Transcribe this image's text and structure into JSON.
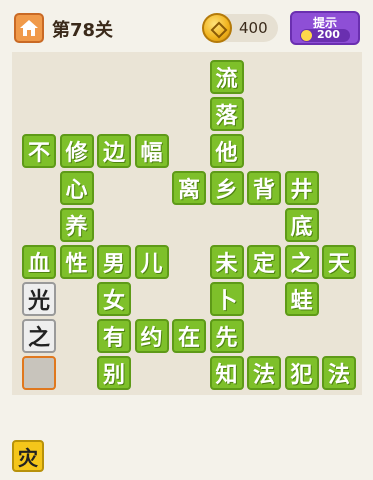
{
  "header": {
    "level_title": "第78关",
    "coins": "400",
    "hint_label": "提示",
    "hint_cost": "200"
  },
  "colors": {
    "tile_green": "#7ec02a",
    "hint_purple": "#8e4fd6",
    "home_orange": "#f09a4a",
    "slot_border": "#e0781e",
    "candidate_yellow": "#f5c61a"
  },
  "board": {
    "cells": [
      {
        "char": "流",
        "row": 0,
        "col": 5,
        "style": "green"
      },
      {
        "char": "落",
        "row": 1,
        "col": 5,
        "style": "green"
      },
      {
        "char": "不",
        "row": 2,
        "col": 0,
        "style": "green"
      },
      {
        "char": "修",
        "row": 2,
        "col": 1,
        "style": "green"
      },
      {
        "char": "边",
        "row": 2,
        "col": 2,
        "style": "green"
      },
      {
        "char": "幅",
        "row": 2,
        "col": 3,
        "style": "green"
      },
      {
        "char": "他",
        "row": 2,
        "col": 5,
        "style": "green"
      },
      {
        "char": "心",
        "row": 3,
        "col": 1,
        "style": "green"
      },
      {
        "char": "离",
        "row": 3,
        "col": 4,
        "style": "green"
      },
      {
        "char": "乡",
        "row": 3,
        "col": 5,
        "style": "green"
      },
      {
        "char": "背",
        "row": 3,
        "col": 6,
        "style": "green"
      },
      {
        "char": "井",
        "row": 3,
        "col": 7,
        "style": "green"
      },
      {
        "char": "养",
        "row": 4,
        "col": 1,
        "style": "green"
      },
      {
        "char": "底",
        "row": 4,
        "col": 7,
        "style": "green"
      },
      {
        "char": "血",
        "row": 5,
        "col": 0,
        "style": "green"
      },
      {
        "char": "性",
        "row": 5,
        "col": 1,
        "style": "green"
      },
      {
        "char": "男",
        "row": 5,
        "col": 2,
        "style": "green"
      },
      {
        "char": "儿",
        "row": 5,
        "col": 3,
        "style": "green"
      },
      {
        "char": "未",
        "row": 5,
        "col": 5,
        "style": "green"
      },
      {
        "char": "定",
        "row": 5,
        "col": 6,
        "style": "green"
      },
      {
        "char": "之",
        "row": 5,
        "col": 7,
        "style": "green"
      },
      {
        "char": "天",
        "row": 5,
        "col": 8,
        "style": "green"
      },
      {
        "char": "光",
        "row": 6,
        "col": 0,
        "style": "gray"
      },
      {
        "char": "女",
        "row": 6,
        "col": 2,
        "style": "green"
      },
      {
        "char": "卜",
        "row": 6,
        "col": 5,
        "style": "green"
      },
      {
        "char": "蛙",
        "row": 6,
        "col": 7,
        "style": "green"
      },
      {
        "char": "之",
        "row": 7,
        "col": 0,
        "style": "gray"
      },
      {
        "char": "有",
        "row": 7,
        "col": 2,
        "style": "green"
      },
      {
        "char": "约",
        "row": 7,
        "col": 3,
        "style": "green"
      },
      {
        "char": "在",
        "row": 7,
        "col": 4,
        "style": "green"
      },
      {
        "char": "先",
        "row": 7,
        "col": 5,
        "style": "green"
      },
      {
        "char": "",
        "row": 8,
        "col": 0,
        "style": "slot"
      },
      {
        "char": "别",
        "row": 8,
        "col": 2,
        "style": "green"
      },
      {
        "char": "知",
        "row": 8,
        "col": 5,
        "style": "green"
      },
      {
        "char": "法",
        "row": 8,
        "col": 6,
        "style": "green"
      },
      {
        "char": "犯",
        "row": 8,
        "col": 7,
        "style": "green"
      },
      {
        "char": "法",
        "row": 8,
        "col": 8,
        "style": "green"
      }
    ]
  },
  "candidates": [
    "灾"
  ]
}
